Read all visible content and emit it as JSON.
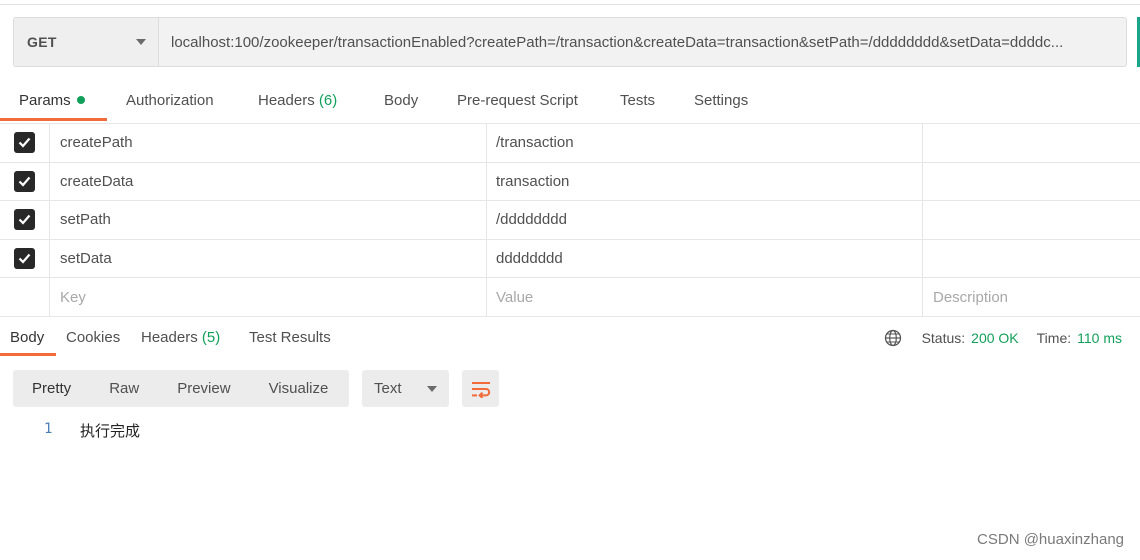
{
  "request": {
    "method": "GET",
    "url": "localhost:100/zookeeper/transactionEnabled?createPath=/transaction&createData=transaction&setPath=/dddddddd&setData=ddddc..."
  },
  "request_tabs": {
    "params": "Params",
    "authorization": "Authorization",
    "headers": "Headers",
    "headers_count": "(6)",
    "body": "Body",
    "pre_request_script": "Pre-request Script",
    "tests": "Tests",
    "settings": "Settings"
  },
  "params": {
    "rows": [
      {
        "key": "createPath",
        "value": "/transaction"
      },
      {
        "key": "createData",
        "value": "transaction"
      },
      {
        "key": "setPath",
        "value": "/dddddddd"
      },
      {
        "key": "setData",
        "value": "dddddddd"
      }
    ],
    "placeholders": {
      "key": "Key",
      "value": "Value",
      "description": "Description"
    }
  },
  "response_tabs": {
    "body": "Body",
    "cookies": "Cookies",
    "headers": "Headers",
    "headers_count": "(5)",
    "test_results": "Test Results"
  },
  "response_status": {
    "status_label": "Status:",
    "status_value": "200 OK",
    "time_label": "Time:",
    "time_value": "110 ms"
  },
  "response_toolbar": {
    "pretty": "Pretty",
    "raw": "Raw",
    "preview": "Preview",
    "visualize": "Visualize",
    "format": "Text"
  },
  "response_body": {
    "line_number": "1",
    "line_text": "执行完成"
  },
  "watermark": "CSDN @huaxinzhang",
  "colors": {
    "accent": "#f26b3a",
    "success": "#11a05a",
    "teal_edge": "#1aa58a"
  }
}
